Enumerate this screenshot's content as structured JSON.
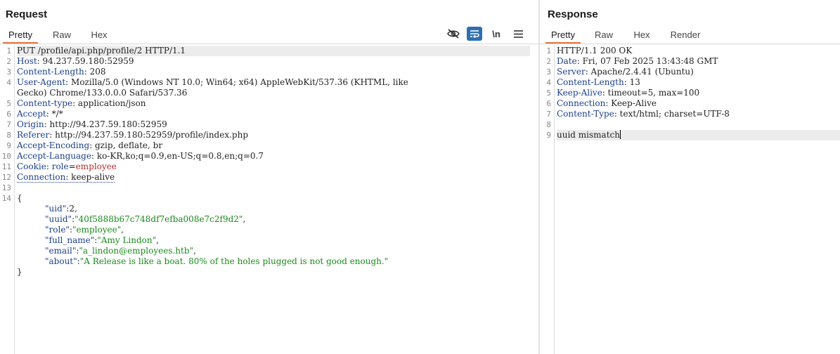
{
  "request": {
    "title": "Request",
    "tabs": [
      "Pretty",
      "Raw",
      "Hex"
    ],
    "active_tab": "Pretty",
    "toolbar": {
      "hide_icon": "eye-slash-icon",
      "wrap_icon": "word-wrap-icon",
      "newline_label": "\\n",
      "menu_icon": "hamburger-menu-icon"
    },
    "line_numbers": [
      "1",
      "2",
      "3",
      "4",
      "",
      "5",
      "6",
      "7",
      "8",
      "9",
      "10",
      "11",
      "12",
      "13",
      "14"
    ],
    "lines": {
      "l1": "PUT /profile/api.php/profile/2 HTTP/1.1",
      "l2k": "Host",
      "l2v": " 94.237.59.180:52959",
      "l3k": "Content-Length",
      "l3v": " 208",
      "l4k": "User-Agent",
      "l4v": " Mozilla/5.0 (Windows NT 10.0; Win64; x64) AppleWebKit/537.36 (KHTML, like",
      "l4b": "Gecko) Chrome/133.0.0.0 Safari/537.36",
      "l5k": "Content-type",
      "l5v": " application/json",
      "l6k": "Accept",
      "l6v": " */*",
      "l7k": "Origin",
      "l7v": " http://94.237.59.180:52959",
      "l8k": "Referer",
      "l8v": " http://94.237.59.180:52959/profile/index.php",
      "l9k": "Accept-Encoding",
      "l9v": " gzip, deflate, br",
      "l10k": "Accept-Language",
      "l10v": " ko-KR,ko;q=0.9,en-US;q=0.8,en;q=0.7",
      "l11k": "Cookie",
      "l11ck": "role",
      "l11cv": "employee",
      "l12k": "Connection",
      "l12v": " keep-alive"
    },
    "body": {
      "open": "{",
      "close": "}",
      "uid_k": "\"uid\"",
      "uid_v": "2",
      "uuid_k": "\"uuid\"",
      "uuid_v": "\"40f5888b67c748df7efba008e7c2f9d2\"",
      "role_k": "\"role\"",
      "role_v": "\"employee\"",
      "name_k": "\"full_name\"",
      "name_v": "\"Amy Lindon\"",
      "email_k": "\"email\"",
      "email_v": "\"a_lindon@employees.htb\"",
      "about_k": "\"about\"",
      "about_v": "\"A Release is like a boat. 80% of the holes plugged is not good enough.\""
    }
  },
  "response": {
    "title": "Response",
    "tabs": [
      "Pretty",
      "Raw",
      "Hex",
      "Render"
    ],
    "active_tab": "Pretty",
    "line_numbers": [
      "1",
      "2",
      "3",
      "4",
      "5",
      "6",
      "7",
      "8",
      "9"
    ],
    "lines": {
      "l1": "HTTP/1.1 200 OK",
      "l2k": "Date",
      "l2v": " Fri, 07 Feb 2025 13:43:48 GMT",
      "l3k": "Server",
      "l3v": " Apache/2.4.41 (Ubuntu)",
      "l4k": "Content-Length",
      "l4v": " 13",
      "l5k": "Keep-Alive",
      "l5v": " timeout=5, max=100",
      "l6k": "Connection",
      "l6v": " Keep-Alive",
      "l7k": "Content-Type",
      "l7v": " text/html; charset=UTF-8",
      "l9": "uuid mismatch"
    }
  },
  "colors": {
    "accent_tab": "#e8743b",
    "active_button": "#2d6fb3",
    "header_key": "#1c3f8f",
    "json_string": "#1a8a1a",
    "cookie_value": "#b32b2b"
  }
}
